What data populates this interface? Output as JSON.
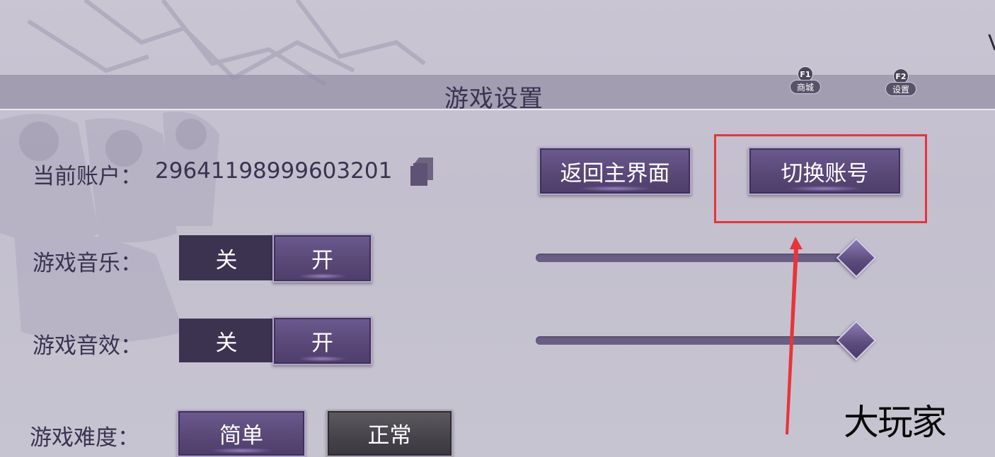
{
  "header": {
    "title": "游戏设置",
    "hotkeys": [
      {
        "key": "F1",
        "label": "商城"
      },
      {
        "key": "F2",
        "label": "设置"
      }
    ],
    "edge_letter": "V"
  },
  "account": {
    "label": "当前账户：",
    "id": "29641198999603201",
    "copy_icon": "copy-icon"
  },
  "actions": {
    "return_main": "返回主界面",
    "switch_account": "切换账号"
  },
  "music": {
    "label": "游戏音乐：",
    "off_label": "关",
    "on_label": "开",
    "state": "on",
    "volume": 1.0
  },
  "sound_effects": {
    "label": "游戏音效：",
    "off_label": "关",
    "on_label": "开",
    "state": "on",
    "volume": 1.0
  },
  "difficulty": {
    "label": "游戏难度：",
    "options": [
      "简单",
      "正常"
    ],
    "selected": "简单"
  },
  "annotation": {
    "highlight_color": "#e8343a",
    "target": "切换账号"
  },
  "watermark": "大玩家",
  "colors": {
    "button_purple": "#5a4878",
    "toggle_off_bg": "#3b3350",
    "title_text": "#3a3350"
  }
}
